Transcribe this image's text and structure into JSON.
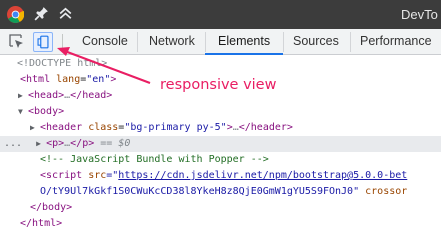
{
  "window": {
    "title": "DevTo"
  },
  "tabs": {
    "console": "Console",
    "network": "Network",
    "elements": "Elements",
    "sources": "Sources",
    "performance": "Performance"
  },
  "annotation": {
    "text": "responsive view"
  },
  "tree": {
    "doctype": "<!DOCTYPE html>",
    "html_open": {
      "tag": "<html",
      "attr": "lang",
      "val": "\"en\"",
      "close": ">"
    },
    "head": {
      "open": "<head>",
      "dots": "…",
      "close": "</head>"
    },
    "body_open": "<body>",
    "header": {
      "open": "<header",
      "attr": "class",
      "val": "\"bg-primary py-5\"",
      "close": ">",
      "dots": "…",
      "end": "</header>"
    },
    "p": {
      "dots_prefix": "...",
      "open": "<p>",
      "dots": "…",
      "close": "</p>",
      "eq": "==",
      "ref": "$0"
    },
    "comment": "<!-- JavaScript Bundle with Popper -->",
    "script": {
      "open": "<script",
      "attr": "src",
      "eq": "=\"",
      "link": "https://cdn.jsdelivr.net/npm/bootstrap@5.0.0-bet"
    },
    "script_cont": {
      "text": "O/tY9Ul7kGkf1S0CWuKcCD38l8YkeH8z8QjE0GmW1gYU5S9FOnJ0",
      "quote": "\"",
      "attr": "crossor"
    },
    "body_close": "</body>",
    "html_close": "</html>"
  }
}
